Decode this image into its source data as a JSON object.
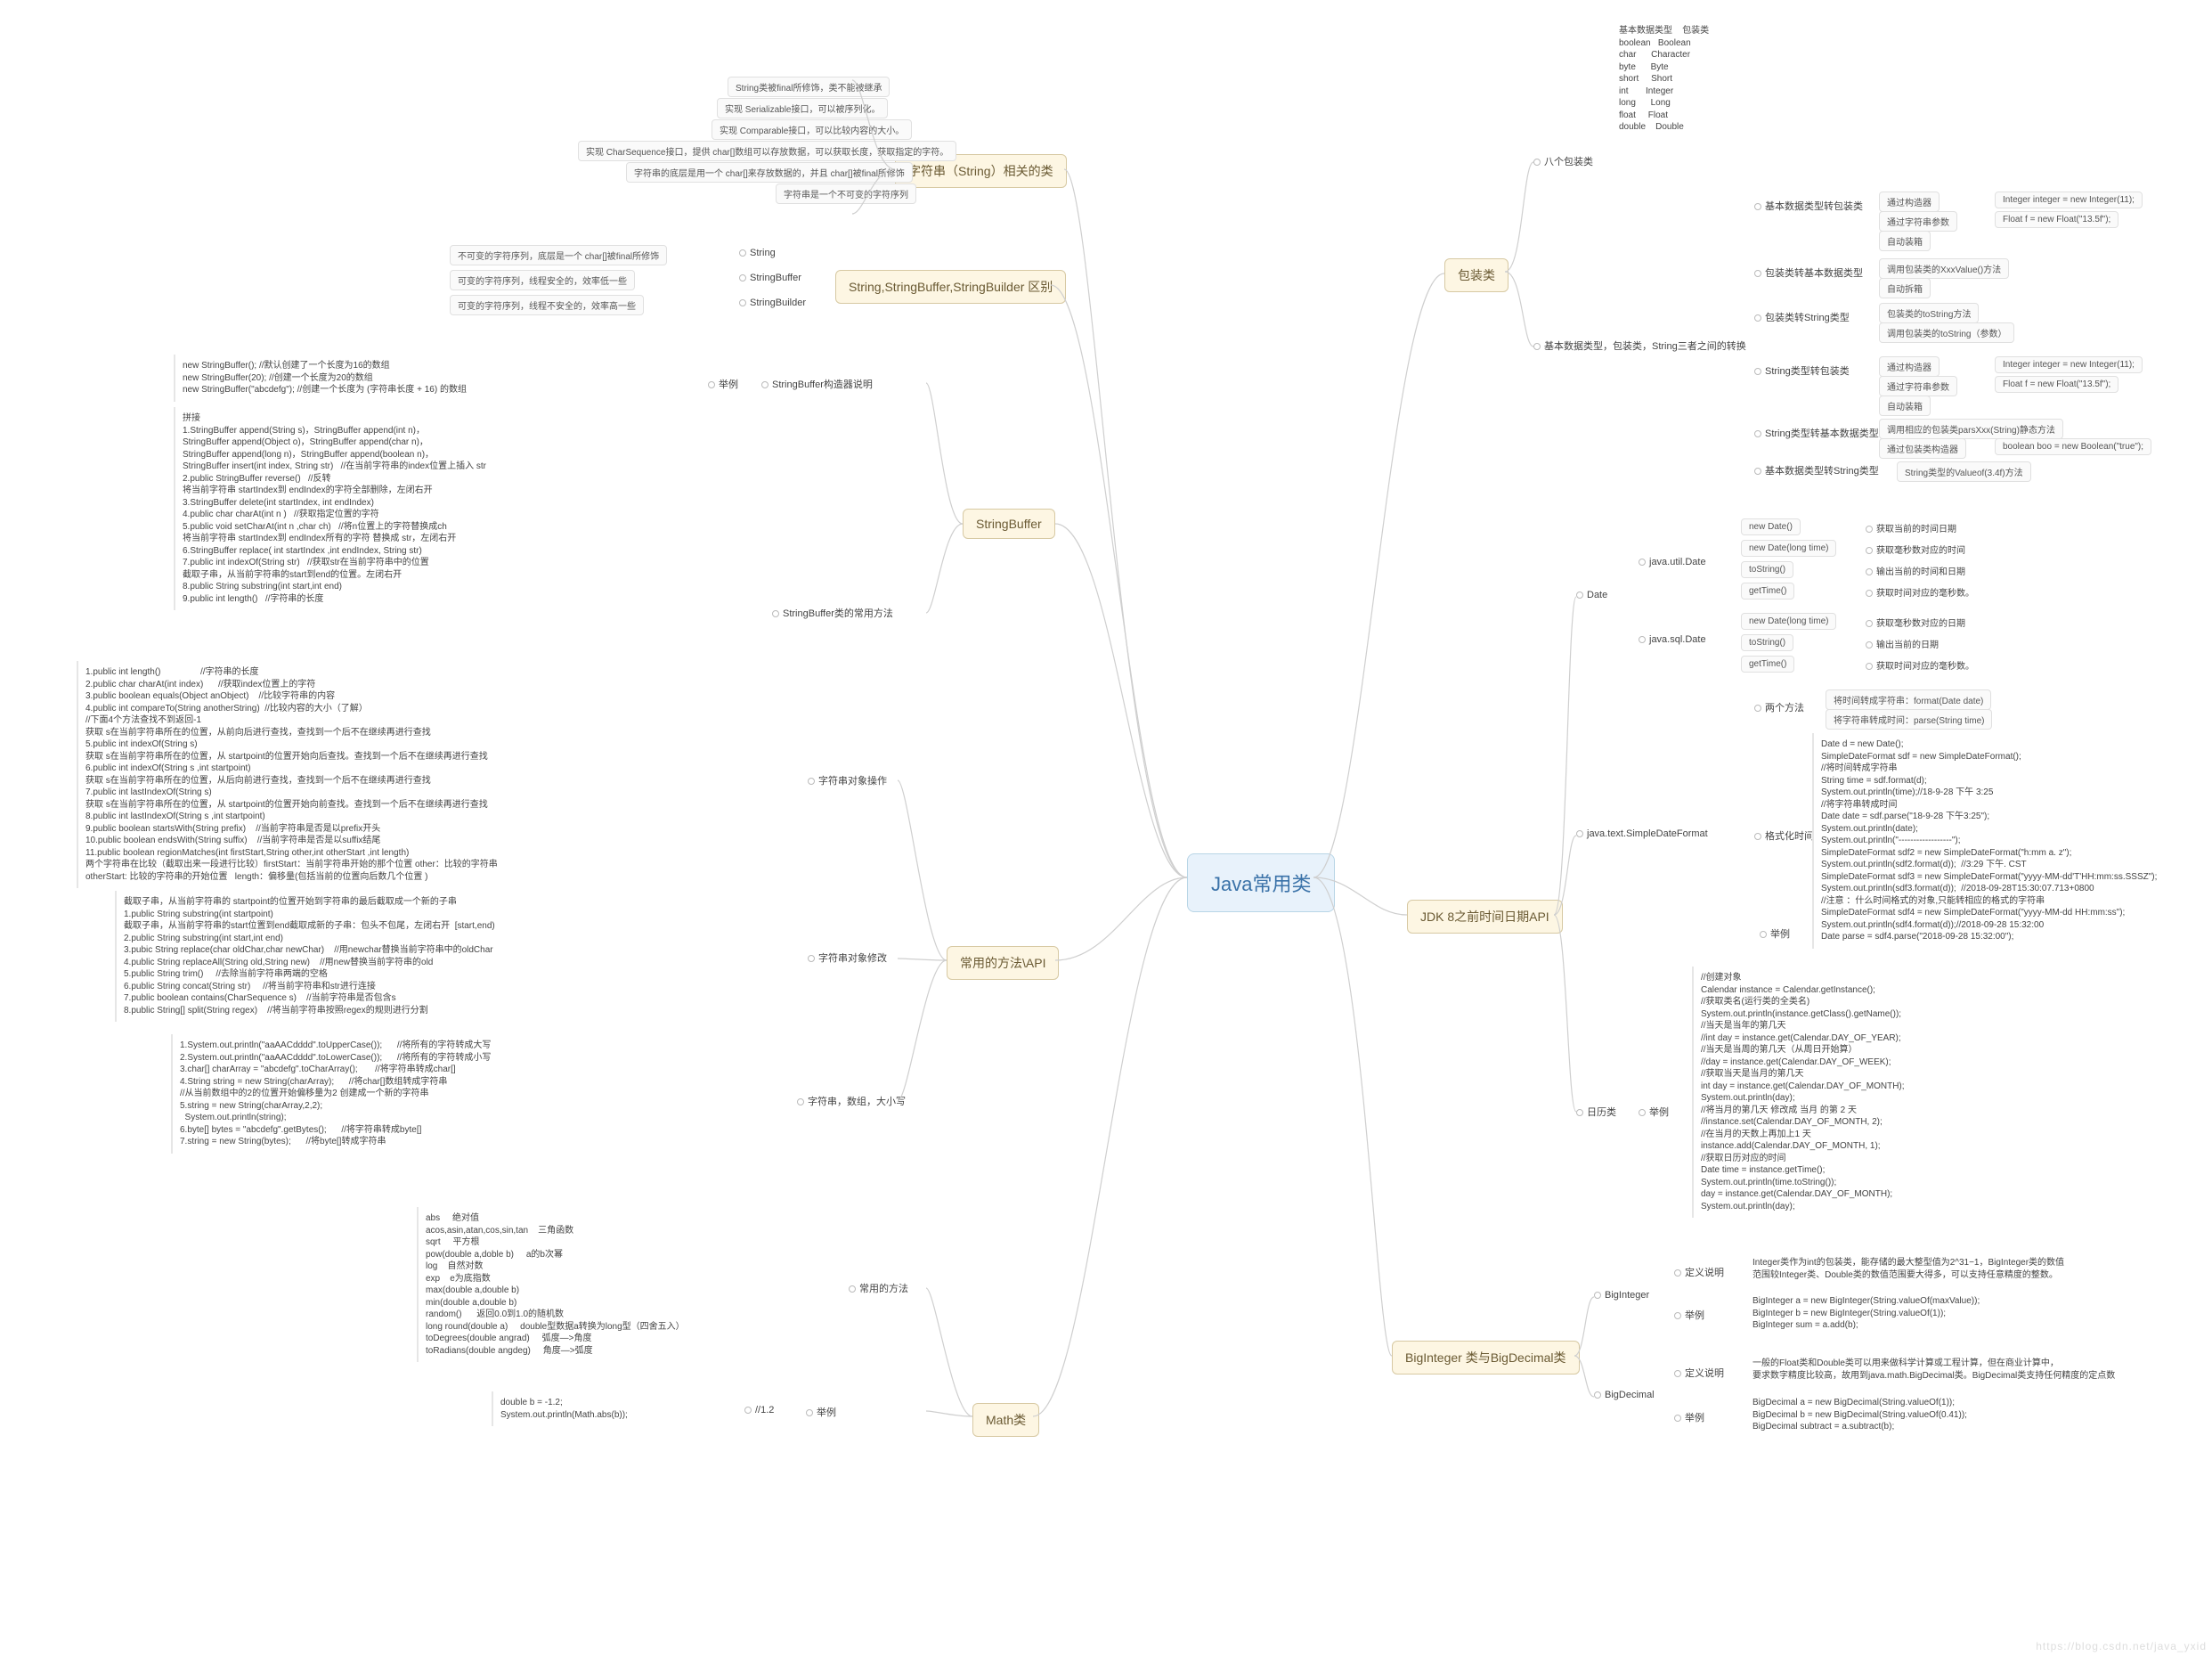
{
  "root": "Java常用类",
  "watermark": "https://blog.csdn.net/java_yxid",
  "left_topics": {
    "string_class": "字符串（String）相关的类",
    "string_diff": "String,StringBuffer,StringBuilder 区别",
    "stringbuffer": "StringBuffer",
    "string_ops": "字符串对象操作",
    "string_mod": "字符串对象修改",
    "string_misc": "字符串，数组，大小写",
    "common_api": "常用的方法\\API",
    "math": "Math类",
    "math_methods": "常用的方法",
    "math_ex": "举例",
    "math_ex_val": "//1.2",
    "sb_ctor": "StringBuffer构造器说明",
    "sb_ctor_ex": "举例",
    "sb_common": "StringBuffer类的常用方法"
  },
  "string_class_leaves": [
    "String类被final所修饰，类不能被继承",
    "实现 Serializable接口，可以被序列化。",
    "实现 Comparable接口，可以比较内容的大小。",
    "实现 CharSequence接口，提供 char[]数组可以存放数据，可以获取长度，获取指定的字符。",
    "字符串的底层是用一个 char[]来存放数据的，并且 char[]被final所修饰",
    "字符串是一个不可变的字符序列"
  ],
  "string_diff_rows": [
    {
      "desc": "不可变的字符序列，底层是一个 char[]被final所修饰",
      "cls": "String"
    },
    {
      "desc": "可变的字符序列，线程安全的，效率低一些",
      "cls": "StringBuffer"
    },
    {
      "desc": "可变的字符序列，线程不安全的，效率高一些",
      "cls": "StringBuilder"
    }
  ],
  "sb_ctor_lines": [
    "new StringBuffer(); //默认创建了一个长度为16的数组",
    "new StringBuffer(20); //创建一个长度为20的数组",
    "new StringBuffer(\"abcdefg\"); //创建一个长度为 (字符串长度 + 16) 的数组"
  ],
  "sb_methods": [
    "拼接",
    "1.StringBuffer append(String s)，StringBuffer append(int n)，",
    "StringBuffer append(Object o)，StringBuffer append(char n)，",
    "StringBuffer append(long n)，StringBuffer append(boolean n)，",
    "StringBuffer insert(int index, String str)   //在当前字符串的index位置上插入 str",
    "2.public StringBuffer reverse()   //反转",
    "将当前字符串 startIndex到 endIndex的字符全部删除，左闭右开",
    "3.StringBuffer delete(int startIndex, int endIndex)",
    "4.public char charAt(int n )   //获取指定位置的字符",
    "5.public void setCharAt(int n ,char ch)   //将n位置上的字符替换成ch",
    "将当前字符串 startIndex到 endIndex所有的字符 替换成 str，左闭右开",
    "6.StringBuffer replace( int startIndex ,int endIndex, String str)",
    "7.public int indexOf(String str)   //获取str在当前字符串中的位置",
    "截取子串，从当前字符串的start到end的位置。左闭右开",
    "8.public String substring(int start,int end)",
    "9.public int length()   //字符串的长度"
  ],
  "string_ops_lines": [
    "1.public int length()                //字符串的长度",
    "2.public char charAt(int index)      //获取index位置上的字符",
    "3.public boolean equals(Object anObject)    //比较字符串的内容",
    "4.public int compareTo(String anotherString)  //比较内容的大小（了解）",
    "//下面4个方法查找不到返回-1",
    "获取 s在当前字符串所在的位置，从前向后进行查找，查找到一个后不在继续再进行查找",
    "5.public int indexOf(String s)",
    "获取 s在当前字符串所在的位置，从 startpoint的位置开始向后查找。查找到一个后不在继续再进行查找",
    "6.public int indexOf(String s ,int startpoint)",
    "获取 s在当前字符串所在的位置，从后向前进行查找，查找到一个后不在继续再进行查找",
    "7.public int lastIndexOf(String s)",
    "获取 s在当前字符串所在的位置，从 startpoint的位置开始向前查找。查找到一个后不在继续再进行查找",
    "8.public int lastIndexOf(String s ,int startpoint)",
    "9.public boolean startsWith(String prefix)    //当前字符串是否是以prefix开头",
    "10.public boolean endsWith(String suffix)    //当前字符串是否是以suffix结尾",
    "11.public boolean regionMatches(int firstStart,String other,int otherStart ,int length)",
    "两个字符串在比较（截取出来一段进行比较）firstStart：当前字符串开始的那个位置 other：比较的字符串",
    "otherStart: 比较的字符串的开始位置   length：偏移量(包括当前的位置向后数几个位置 )"
  ],
  "string_mod_lines": [
    "截取子串，从当前字符串的 startpoint的位置开始到字符串的最后截取成一个新的子串",
    "1.public String substring(int startpoint)",
    "截取子串，从当前字符串的start位置到end截取成新的子串：包头不包尾，左闭右开  [start,end)",
    "2.public String substring(int start,int end)",
    "3.pubic String replace(char oldChar,char newChar)    //用newchar替换当前字符串中的oldChar",
    "4.public String replaceAll(String old,String new)    //用new替换当前字符串的old",
    "5.public String trim()     //去除当前字符串两端的空格",
    "6.public String concat(String str)     //将当前字符串和str进行连接",
    "7.public boolean contains(CharSequence s)    //当前字符串是否包含s",
    "8.public String[] split(String regex)    //将当前字符串按照regex的规则进行分割"
  ],
  "string_misc_lines": [
    "1.System.out.println(\"aaAACdddd\".toUpperCase());      //将所有的字符转成大写",
    "2.System.out.println(\"aaAACdddd\".toLowerCase());      //将所有的字符转成小写",
    "3.char[] charArray = \"abcdefg\".toCharArray();       //将字符串转成char[]",
    "4.String string = new String(charArray);      //将char[]数组转成字符串",
    "//从当前数组中的2的位置开始偏移量为2 创建成一个新的字符串",
    "5.string = new String(charArray,2,2);",
    "  System.out.println(string);",
    "6.byte[] bytes = \"abcdefg\".getBytes();      //将字符串转成byte[]",
    "7.string = new String(bytes);      //将byte[]转成字符串"
  ],
  "math_lines": [
    "abs     绝对值",
    "acos,asin,atan,cos,sin,tan    三角函数",
    "sqrt     平方根",
    "pow(double a,doble b)     a的b次幂",
    "log    自然对数",
    "exp    e为底指数",
    "max(double a,double b)",
    "min(double a,double b)",
    "random()      返回0.0到1.0的随机数",
    "long round(double a)     double型数据a转换为long型（四舍五入）",
    "toDegrees(double angrad)     弧度—>角度",
    "toRadians(double angdeg)     角度—>弧度"
  ],
  "math_ex_lines": [
    "double b = -1.2;",
    "System.out.println(Math.abs(b));"
  ],
  "right_topics": {
    "wrapper": "包装类",
    "wrapper8": "八个包装类",
    "wrapper_convert": "基本数据类型，包装类，String三者之间的转换",
    "date": "Date",
    "sdf": "java.text.SimpleDateFormat",
    "jdk8": "JDK 8之前时间日期API",
    "calendar": "日历类",
    "bigint": "BigInteger",
    "bigdec": "BigDecimal",
    "bignum": "BigInteger 类与BigDecimal类"
  },
  "wrapper_table_header": {
    "col1": "基本数据类型",
    "col2": "包装类"
  },
  "wrapper_table": [
    [
      "boolean",
      "Boolean"
    ],
    [
      "char",
      "Character"
    ],
    [
      "byte",
      "Byte"
    ],
    [
      "short",
      "Short"
    ],
    [
      "int",
      "Integer"
    ],
    [
      "long",
      "Long"
    ],
    [
      "float",
      "Float"
    ],
    [
      "double",
      "Double"
    ]
  ],
  "wrap_prim_to_wrap": {
    "label": "基本数据类型转包装类",
    "rows": [
      {
        "m": "通过构造器",
        "ex": "Integer integer = new Integer(11);"
      },
      {
        "m": "通过字符串参数",
        "ex": "Float f = new Float(\"13.5f\");"
      },
      {
        "m": "自动装箱",
        "ex": ""
      }
    ]
  },
  "wrap_wrap_to_prim": {
    "label": "包装类转基本数据类型",
    "rows": [
      {
        "m": "调用包装类的XxxValue()方法",
        "ex": ""
      },
      {
        "m": "自动拆箱",
        "ex": ""
      }
    ]
  },
  "wrap_wrap_to_str": {
    "label": "包装类转String类型",
    "rows": [
      {
        "m": "包装类的toString方法",
        "ex": ""
      },
      {
        "m": "调用包装类的toString（参数）",
        "ex": ""
      }
    ]
  },
  "wrap_str_to_wrap": {
    "label": "String类型转包装类",
    "rows": [
      {
        "m": "通过构造器",
        "ex": "Integer integer = new Integer(11);"
      },
      {
        "m": "通过字符串参数",
        "ex": "Float f = new Float(\"13.5f\");"
      },
      {
        "m": "自动装箱",
        "ex": ""
      }
    ]
  },
  "wrap_str_to_prim": {
    "label": "String类型转基本数据类型",
    "rows": [
      {
        "m": "调用相应的包装类parsXxx(String)静态方法",
        "ex": ""
      },
      {
        "m": "通过包装类构造器",
        "ex": "boolean boo = new Boolean(\"true\");"
      }
    ]
  },
  "wrap_prim_to_str": {
    "label": "基本数据类型转String类型",
    "val": "String类型的Valueof(3.4f)方法"
  },
  "date_util": {
    "label": "java.util.Date",
    "rows": [
      {
        "m": "new Date()",
        "d": "获取当前的时间日期"
      },
      {
        "m": "new Date(long time)",
        "d": "获取毫秒数对应的时间"
      },
      {
        "m": "toString()",
        "d": "输出当前的时间和日期"
      },
      {
        "m": "getTime()",
        "d": "获取时间对应的毫秒数。"
      }
    ]
  },
  "date_sql": {
    "label": "java.sql.Date",
    "rows": [
      {
        "m": "new Date(long time)",
        "d": "获取毫秒数对应的日期"
      },
      {
        "m": "toString()",
        "d": "输出当前的日期"
      },
      {
        "m": "getTime()",
        "d": "获取时间对应的毫秒数。"
      }
    ]
  },
  "sdf_two": {
    "label": "两个方法",
    "rows": [
      "将时间转成字符串：format(Date date)",
      "将字符串转成时间：parse(String time)"
    ]
  },
  "sdf_fmt_label": "格式化时间",
  "sdf_ex_label": "举例",
  "sdf_lines": [
    "Date d = new Date();",
    "SimpleDateFormat sdf = new SimpleDateFormat();",
    "//将时间转成字符串",
    "String time = sdf.format(d);",
    "System.out.println(time);//18-9-28 下午 3:25",
    "//将字符串转成时间",
    "Date date = sdf.parse(\"18-9-28 下午3:25\");",
    "System.out.println(date);",
    "System.out.println(\"------------------\");",
    "SimpleDateFormat sdf2 = new SimpleDateFormat(\"h:mm a. z\");",
    "System.out.println(sdf2.format(d));  //3:29 下午. CST",
    "SimpleDateFormat sdf3 = new SimpleDateFormat(\"yyyy-MM-dd'T'HH:mm:ss.SSSZ\");",
    "System.out.println(sdf3.format(d));  //2018-09-28T15:30:07.713+0800",
    "//注意 ：什么时间格式的对象,只能转相应的格式的字符串",
    "SimpleDateFormat sdf4 = new SimpleDateFormat(\"yyyy-MM-dd HH:mm:ss\");",
    "System.out.println(sdf4.format(d));//2018-09-28 15:32:00",
    "Date parse = sdf4.parse(\"2018-09-28 15:32:00\");"
  ],
  "cal_ex_label": "举例",
  "cal_lines": [
    "//创建对象",
    "Calendar instance = Calendar.getInstance();",
    "//获取类名(运行类的全类名)",
    "System.out.println(instance.getClass().getName());",
    "//当天是当年的第几天",
    "//int day = instance.get(Calendar.DAY_OF_YEAR);",
    "//当天是当周的第几天（从周日开始算）",
    "//day = instance.get(Calendar.DAY_OF_WEEK);",
    "//获取当天是当月的第几天",
    "int day = instance.get(Calendar.DAY_OF_MONTH);",
    "System.out.println(day);",
    "//将当月的第几天 修改成 当月 的第 2 天",
    "//instance.set(Calendar.DAY_OF_MONTH, 2);",
    "//在当月的天数上再加上1 天",
    "instance.add(Calendar.DAY_OF_MONTH, 1);",
    "//获取日历对应的时间",
    "Date time = instance.getTime();",
    "System.out.println(time.toString());",
    "day = instance.get(Calendar.DAY_OF_MONTH);",
    "System.out.println(day);"
  ],
  "bigint_def_label": "定义说明",
  "bigint_def": [
    "Integer类作为int的包装类，能存储的最大整型值为2^31−1，BigInteger类的数值",
    "范围较Integer类、Double类的数值范围要大得多，可以支持任意精度的整数。"
  ],
  "bigint_ex_label": "举例",
  "bigint_ex": [
    "BigInteger a = new BigInteger(String.valueOf(maxValue));",
    "BigInteger b = new BigInteger(String.valueOf(1));",
    "BigInteger sum = a.add(b);"
  ],
  "bigdec_def_label": "定义说明",
  "bigdec_def": [
    "一般的Float类和Double类可以用来做科学计算或工程计算，但在商业计算中，",
    "要求数字精度比较高，故用到java.math.BigDecimal类。BigDecimal类支持任何精度的定点数"
  ],
  "bigdec_ex_label": "举例",
  "bigdec_ex": [
    "BigDecimal a = new BigDecimal(String.valueOf(1));",
    "BigDecimal b = new BigDecimal(String.valueOf(0.41));",
    "BigDecimal subtract = a.subtract(b);"
  ]
}
